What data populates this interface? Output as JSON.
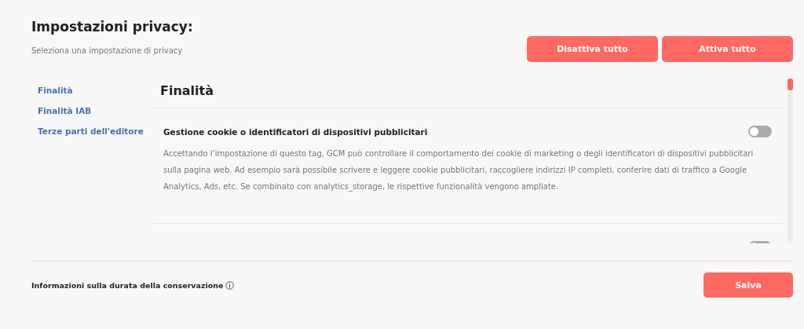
{
  "header": {
    "title": "Impostazioni privacy:",
    "subtitle": "Seleziona una impostazione di privacy",
    "buttons": [
      "Disattiva tutto",
      "Attiva tutto"
    ]
  },
  "sidebar": {
    "items": [
      {
        "label": "Finalità",
        "selected": false
      },
      {
        "label": "Finalità IAB",
        "selected": false
      },
      {
        "label": "Terze parti dell'editore",
        "selected": false
      }
    ]
  },
  "section": {
    "title": "Finalità",
    "purposes": [
      {
        "title": "Gestione cookie o identificatori di dispositivi pubblicitari",
        "on": false,
        "description": "Accettando l’impostazione di questo tag, GCM può controllare il comportamento dei cookie di marketing o degli identificatori di dispositivi pubblicitari sulla pagina web. Ad esempio sarà possibile scrivere e leggere cookie pubblicitari, raccogliere indirizzi IP completi, conferire dati di traffico a Google Analytics, Ads, etc. Se combinato con analytics_storage, le rispettive funzionalità vengono ampliate."
      },
      {
        "on": false
      }
    ]
  },
  "footer": {
    "retention_link": "Informazioni sulla durata della conservazione",
    "save_button": "Salva"
  }
}
